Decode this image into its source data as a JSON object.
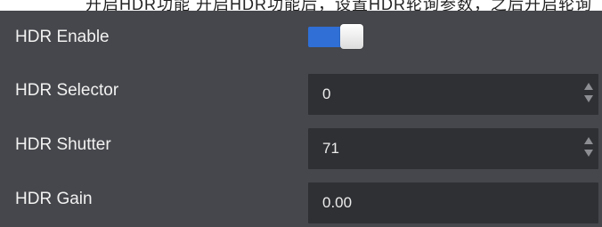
{
  "header": {
    "cutoff_text": "开启HDR功能    开启HDR功能后，设置HDR轮询参数，之后开启轮询"
  },
  "settings": {
    "hdr_enable": {
      "label": "HDR Enable",
      "enabled": true
    },
    "hdr_selector": {
      "label": "HDR Selector",
      "value": "0"
    },
    "hdr_shutter": {
      "label": "HDR Shutter",
      "value": "71"
    },
    "hdr_gain": {
      "label": "HDR Gain",
      "value": "0.00"
    }
  },
  "colors": {
    "panel_bg": "#46474c",
    "field_bg": "#2f3034",
    "accent": "#2f6fd6"
  }
}
